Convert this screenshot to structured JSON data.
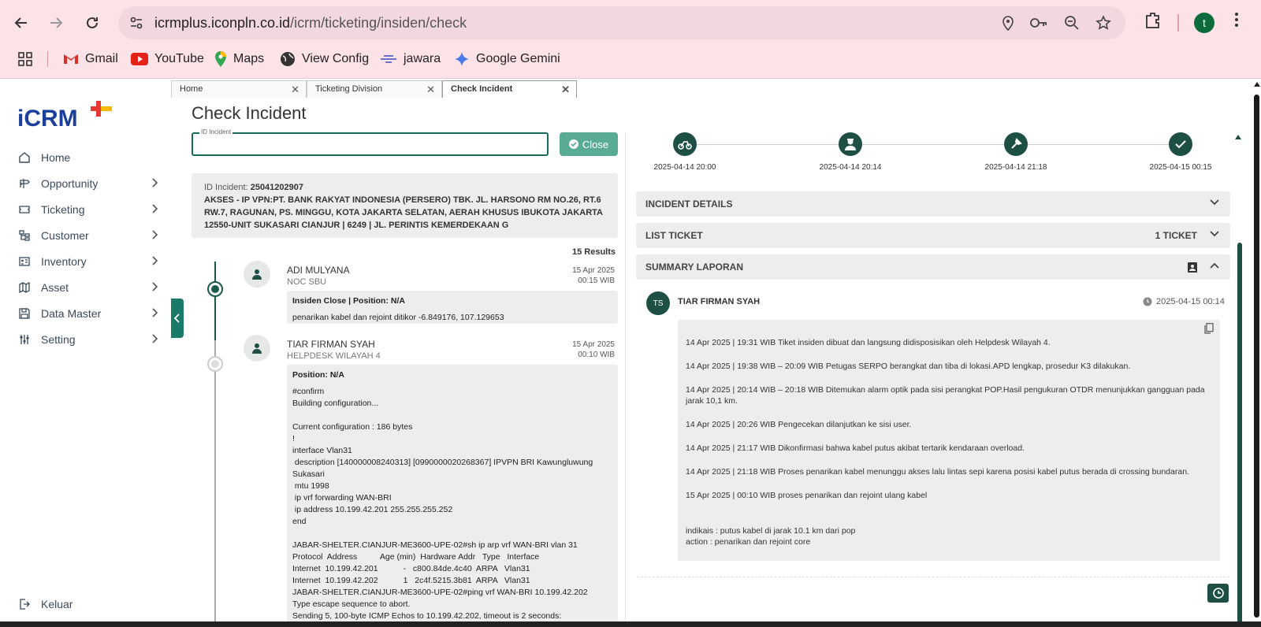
{
  "browser": {
    "url_host": "icrmplus.iconpln.co.id",
    "url_path": "/icrm/ticketing/insiden/check",
    "profile_initial": "t",
    "bookmarks": [
      {
        "label": "Gmail"
      },
      {
        "label": "YouTube"
      },
      {
        "label": "Maps"
      },
      {
        "label": "View Config"
      },
      {
        "label": "jawara"
      },
      {
        "label": "Google Gemini"
      }
    ]
  },
  "sidebar": {
    "items": [
      {
        "label": "Home"
      },
      {
        "label": "Opportunity"
      },
      {
        "label": "Ticketing"
      },
      {
        "label": "Customer"
      },
      {
        "label": "Inventory"
      },
      {
        "label": "Asset"
      },
      {
        "label": "Data Master"
      },
      {
        "label": "Setting"
      }
    ],
    "logout": "Keluar"
  },
  "tabs": [
    {
      "label": "Home"
    },
    {
      "label": "Ticketing Division"
    },
    {
      "label": "Check Incident"
    }
  ],
  "page": {
    "title": "Check Incident",
    "id_field_label": "ID Incident",
    "id_field_value": "",
    "close_label": "Close"
  },
  "incident": {
    "id_label": "ID Incident:",
    "id_value": "25041202907",
    "description": "AKSES - IP VPN:PT. BANK RAKYAT INDONESIA (PERSERO) TBK. JL. HARSONO RM NO.26, RT.6 RW.7, RAGUNAN, PS. MINGGU, KOTA JAKARTA SELATAN, AERAH KHUSUS IBUKOTA JAKARTA 12550-UNIT SUKASARI CIANJUR | 6249 | JL. PERINTIS KEMERDEKAAN G",
    "results": "15 Results"
  },
  "timeline": [
    {
      "name": "ADI MULYANA",
      "role": "NOC SBU",
      "date": "15 Apr 2025",
      "time": "00:15 WIB",
      "header": "Insiden Close | Position: N/A",
      "body": "penarikan kabel dan rejoint ditikor -6.849176, 107.129653"
    },
    {
      "name": "TIAR FIRMAN SYAH",
      "role": "HELPDESK WILAYAH 4",
      "date": "15 Apr 2025",
      "time": "00:10 WIB",
      "header": "Position: N/A",
      "body": "#confirm\nBuilding configuration...\n\nCurrent configuration : 186 bytes\n!\ninterface Vlan31\n description [140000008240313] [0990000020268367] IPVPN BRI Kawungluwung Sukasari\n mtu 1998\n ip vrf forwarding WAN-BRI\n ip address 10.199.42.201 255.255.255.252\nend\n\nJABAR-SHELTER.CIANJUR-ME3600-UPE-02#sh ip arp vrf WAN-BRI vlan 31\nProtocol  Address          Age (min)  Hardware Addr   Type   Interface\nInternet  10.199.42.201           -   c800.84de.4c40  ARPA   Vlan31\nInternet  10.199.42.202           1   2c4f.5215.3b81  ARPA   Vlan31\nJABAR-SHELTER.CIANJUR-ME3600-UPE-02#ping vrf WAN-BRI 10.199.42.202\nType escape sequence to abort.\nSending 5, 100-byte ICMP Echos to 10.199.42.202, timeout is 2 seconds:"
    }
  ],
  "steps": [
    {
      "icon": "motorbike-icon",
      "date": "2025-04-14 20:00"
    },
    {
      "icon": "technician-icon",
      "date": "2025-04-14 20:14"
    },
    {
      "icon": "tool-icon",
      "date": "2025-04-14 21:18"
    },
    {
      "icon": "check-icon",
      "date": "2025-04-15 00:15"
    }
  ],
  "sections": {
    "incident_details": "INCIDENT DETAILS",
    "list_ticket": "LIST TICKET",
    "ticket_count": "1 TICKET",
    "summary": "SUMMARY LAPORAN"
  },
  "summary": {
    "initials": "TS",
    "name": "TIAR FIRMAN SYAH",
    "time": "2025-04-15 00:14",
    "lines": [
      "14 Apr 2025 | 19:31 WIB Tiket insiden dibuat dan langsung didisposisikan oleh Helpdesk Wilayah 4.",
      "14 Apr 2025 | 19:38 WIB – 20:09 WIB Petugas SERPO berangkat dan tiba di lokasi.APD lengkap, prosedur K3 dilakukan.",
      "14 Apr 2025 | 20:14 WIB – 20:18 WIB Ditemukan alarm optik pada sisi perangkat POP.Hasil pengukuran OTDR menunjukkan gangguan pada jarak 10,1 km.",
      "14 Apr 2025 | 20:26 WIB Pengecekan dilanjutkan ke sisi user.",
      "14 Apr 2025 | 21:17 WIB Dikonfirmasi bahwa kabel putus akibat tertarik kendaraan overload.",
      "14 Apr 2025 | 21:18 WIB Proses penarikan kabel menunggu akses lalu lintas sepi karena posisi kabel putus berada di crossing bundaran.",
      "15 Apr 2025 | 00:10 WIB proses penarikan dan rejoint ulang kabel"
    ],
    "indikasi": "indikais : putus kabel di jarak 10.1 km dari pop",
    "action": "action : penarikan dan rejoint core"
  },
  "colors": {
    "brand": "#1d4f45",
    "close_button": "#5aab96",
    "chrome": "#fde2e8"
  }
}
